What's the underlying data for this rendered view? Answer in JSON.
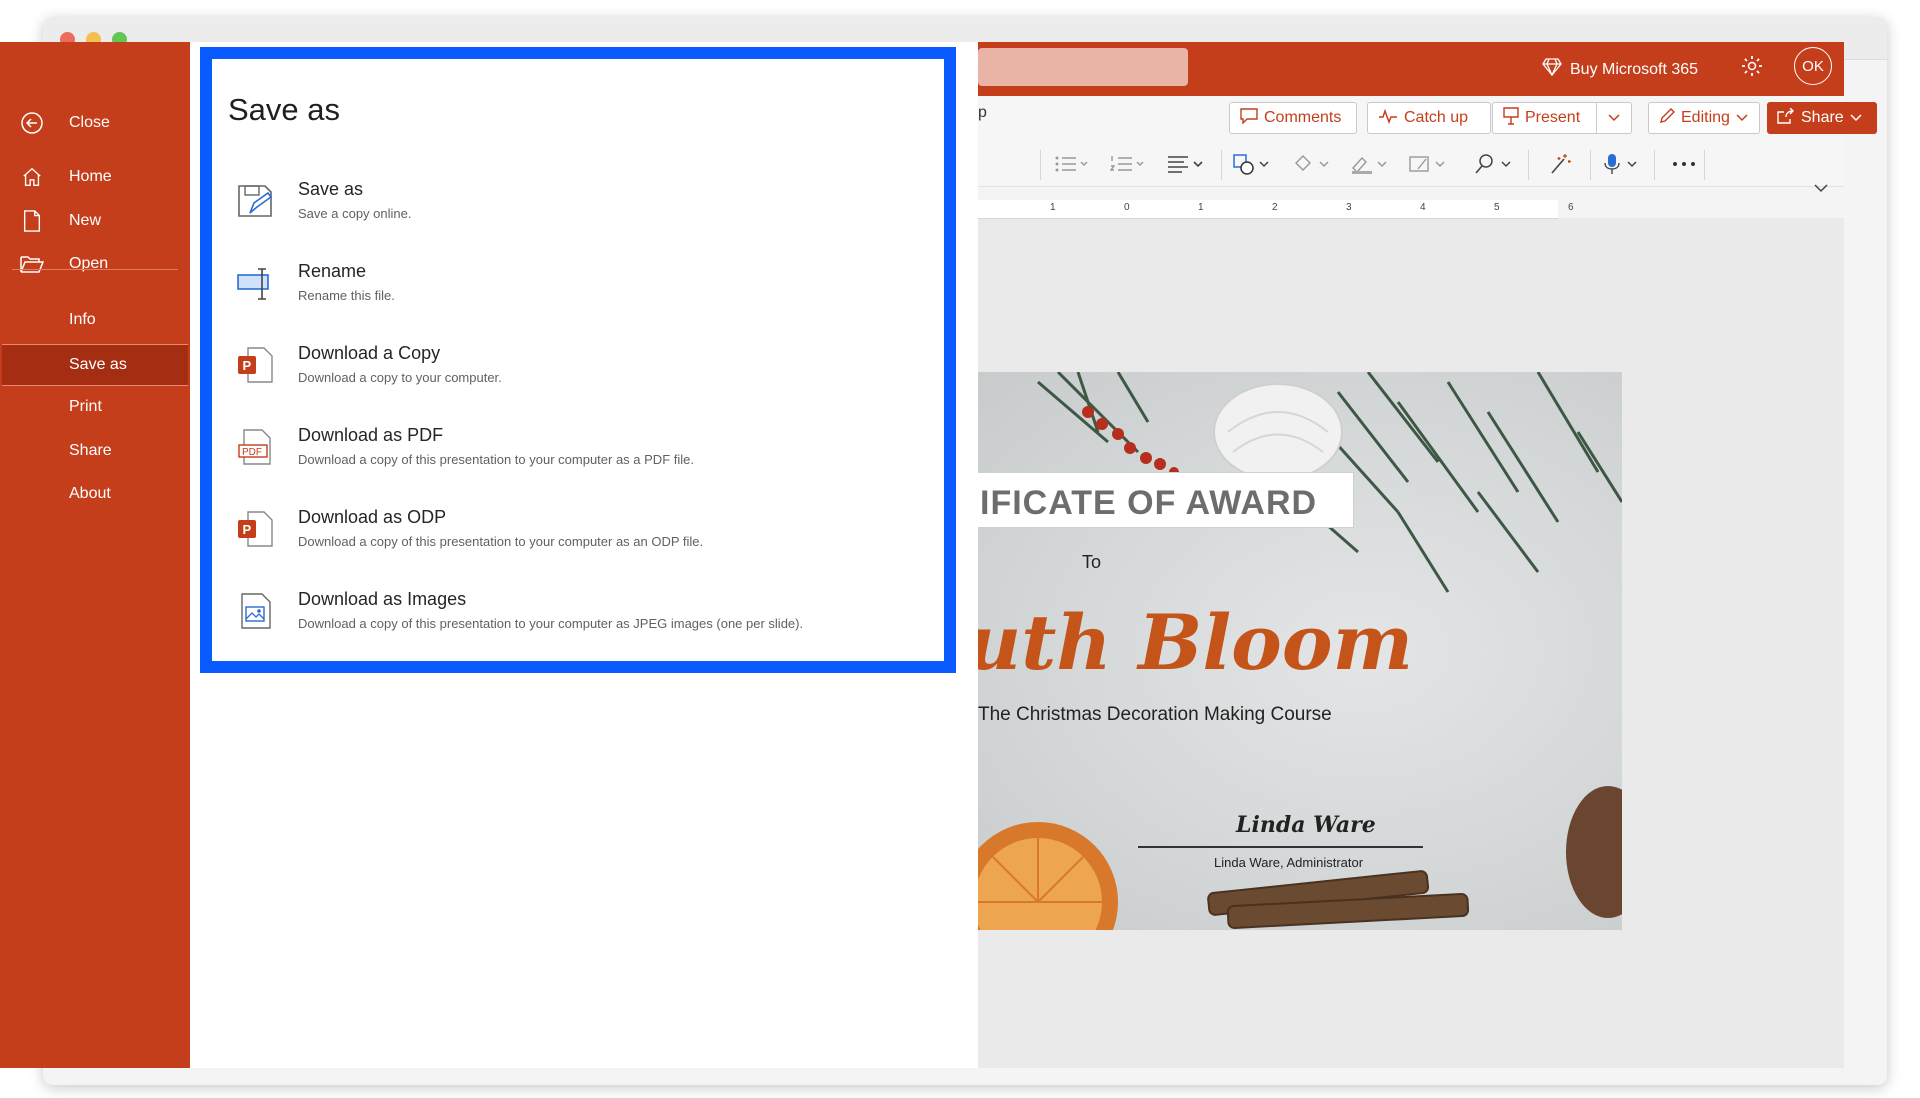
{
  "nav": {
    "close": "Close",
    "home": "Home",
    "new": "New",
    "open": "Open",
    "info": "Info",
    "save_as": "Save as",
    "print": "Print",
    "share": "Share",
    "about": "About"
  },
  "panel": {
    "title": "Save as",
    "options": [
      {
        "title": "Save as",
        "desc": "Save a copy online."
      },
      {
        "title": "Rename",
        "desc": "Rename this file."
      },
      {
        "title": "Download a Copy",
        "desc": "Download a copy to your computer."
      },
      {
        "title": "Download as PDF",
        "desc": "Download a copy of this presentation to your computer as a PDF file."
      },
      {
        "title": "Download as ODP",
        "desc": "Download a copy of this presentation to your computer as an ODP file."
      },
      {
        "title": "Download as Images",
        "desc": "Download a copy of this presentation to your computer as JPEG images (one per slide)."
      }
    ]
  },
  "header": {
    "buy": "Buy Microsoft 365",
    "avatar": "OK",
    "tab_fragment": "p"
  },
  "commands": {
    "comments": "Comments",
    "catch_up": "Catch up",
    "present": "Present",
    "editing": "Editing",
    "share": "Share"
  },
  "ruler": [
    "1",
    "0",
    "1",
    "2",
    "3",
    "4",
    "5",
    "6"
  ],
  "slide": {
    "award": "IFICATE OF AWARD",
    "to": "To",
    "recipient": "uth Bloom",
    "course": "The Christmas Decoration Making Course",
    "signature": "Linda Ware",
    "signer": "Linda Ware, Administrator"
  },
  "colors": {
    "brand": "#c43e1c",
    "highlight": "#0a5bff",
    "recipient": "#c4541a"
  }
}
